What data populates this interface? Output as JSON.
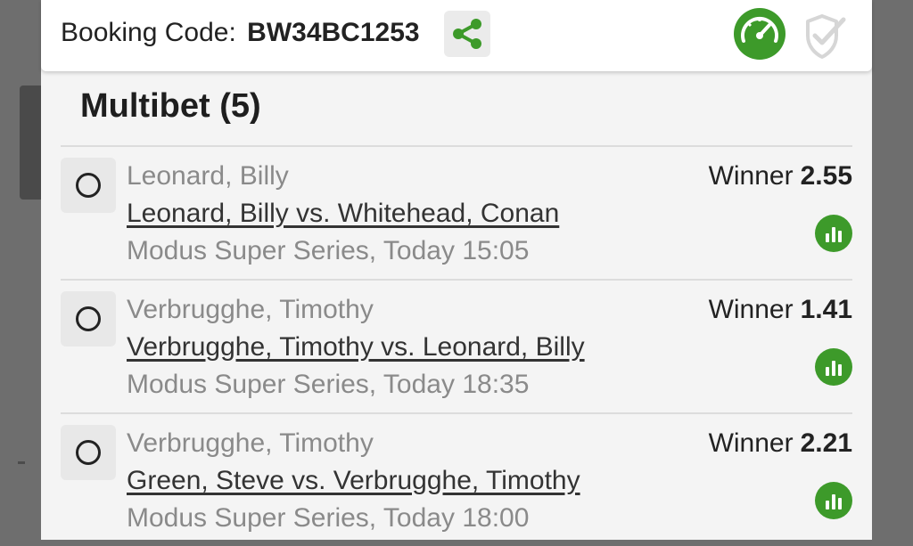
{
  "header": {
    "booking_label": "Booking Code:",
    "booking_code": "BW34BC1253",
    "share_icon": "share-icon",
    "gauge_icon": "speedometer-icon",
    "shield_icon": "shield-check-icon"
  },
  "colors": {
    "accent": "#3d9a2a",
    "muted_text": "#8a8a8a",
    "panel_bg": "#f4f4f4"
  },
  "section": {
    "title": "Multibet (5)"
  },
  "bets": [
    {
      "pick": "Leonard, Billy",
      "match": "Leonard, Billy vs. Whitehead, Conan",
      "meta": "Modus Super Series, Today 15:05",
      "market": "Winner",
      "odds": "2.55"
    },
    {
      "pick": "Verbrugghe, Timothy",
      "match": "Verbrugghe, Timothy vs. Leonard, Billy",
      "meta": "Modus Super Series, Today 18:35",
      "market": "Winner",
      "odds": "1.41"
    },
    {
      "pick": "Verbrugghe, Timothy",
      "match": "Green, Steve vs. Verbrugghe, Timothy",
      "meta": "Modus Super Series, Today 18:00",
      "market": "Winner",
      "odds": "2.21"
    }
  ]
}
